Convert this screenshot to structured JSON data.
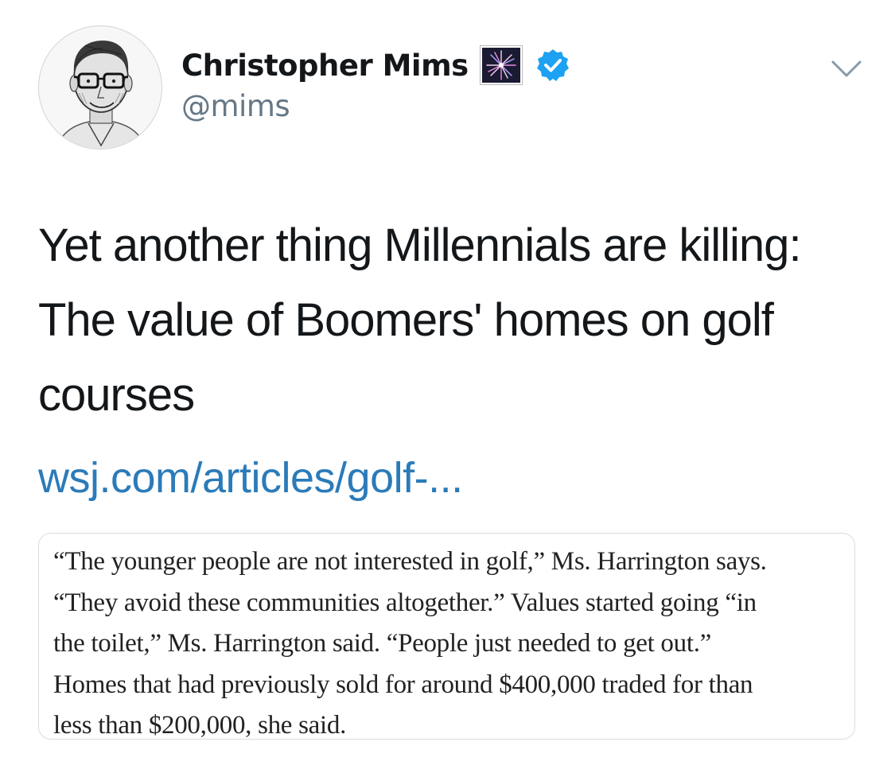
{
  "author": {
    "display_name": "Christopher Mims",
    "handle": "@mims",
    "name_emoji": "fireworks",
    "verified": true
  },
  "icons": {
    "avatar": "portrait-sketch",
    "badge": "fireworks-emoji-icon",
    "verified": "verified-badge-icon",
    "menu": "chevron-down-icon"
  },
  "colors": {
    "text": "#14171a",
    "secondary": "#657786",
    "link": "#2b7bb9",
    "verified": "#1da1f2"
  },
  "tweet": {
    "text_lines": [
      "Yet another thing Millennials are killing:",
      "The value of Boomers' homes on golf",
      "courses"
    ],
    "link_text": "wsj.com/articles/golf-..."
  },
  "quote_card": {
    "lines": [
      "“The younger people are not interested in golf,” Ms. Harrington says.",
      "“They avoid these communities altogether.” Values started going “in",
      "the toilet,” Ms. Harrington said. “People just needed to get out.”",
      "Homes that had previously sold for around $400,000 traded for than",
      "less than $200,000, she said."
    ]
  }
}
